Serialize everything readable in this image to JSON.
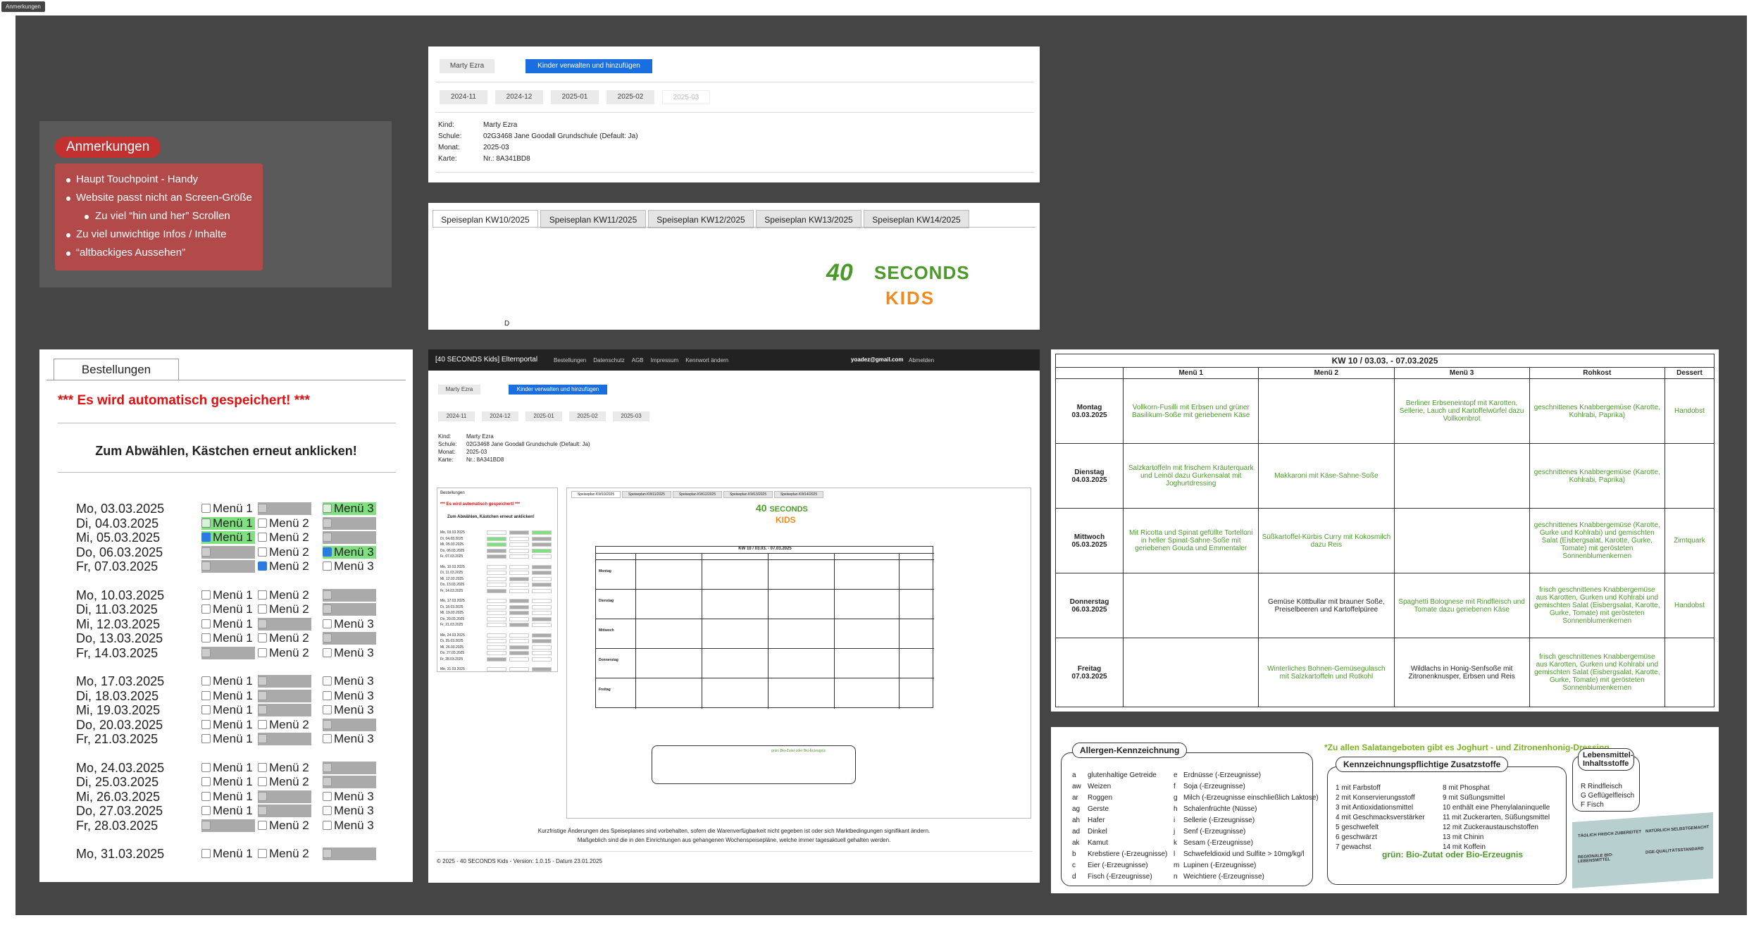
{
  "tag": "Anmerkungen",
  "notes": {
    "title": "Anmerkungen",
    "items": [
      {
        "text": "Haupt Touchpoint - Handy",
        "sub": false
      },
      {
        "text": "Website passt nicht an Screen-Größe",
        "sub": false
      },
      {
        "text": "Zu viel “hin und her” Scrollen",
        "sub": true
      },
      {
        "text": "Zu viel unwichtige Infos / Inhalte",
        "sub": false
      },
      {
        "text": "“altbackiges Aussehen”",
        "sub": false
      }
    ]
  },
  "header_card": {
    "user_button": "Marty Ezra",
    "manage_button": "Kinder verwalten und hinzufügen",
    "months": [
      "2024-11",
      "2024-12",
      "2025-01",
      "2025-02",
      "2025-03"
    ],
    "info": [
      {
        "k": "Kind:",
        "v": "Marty Ezra"
      },
      {
        "k": "Schule:",
        "v": "02G3468 Jane Goodall Grundschule (Default: Ja)"
      },
      {
        "k": "Monat:",
        "v": "2025-03"
      },
      {
        "k": "Karte:",
        "v": "Nr.: 8A341BD8"
      }
    ]
  },
  "tabs_card": {
    "tabs": [
      "Speiseplan KW10/2025",
      "Speiseplan KW11/2025",
      "Speiseplan KW12/2025",
      "Speiseplan KW13/2025",
      "Speiseplan KW14/2025"
    ],
    "logo_top": "SECONDS",
    "logo_num": "40",
    "logo_kids": "KIDS",
    "marker": "D"
  },
  "orders": {
    "tab": "Bestellungen",
    "autosave": "*** Es wird automatisch gespeichert! ***",
    "hint": "Zum Abwählen, Kästchen erneut anklicken!",
    "menu1": "Menü 1",
    "menu2": "Menü 2",
    "menu3": "Menü 3",
    "rows": [
      {
        "date": "Mo, 03.03.2025",
        "m": [
          "u",
          "b",
          "g"
        ]
      },
      {
        "date": "Di, 04.03.2025",
        "m": [
          "g",
          "u",
          "b"
        ]
      },
      {
        "date": "Mi, 05.03.2025",
        "m": [
          "gc",
          "u",
          "b"
        ]
      },
      {
        "date": "Do, 06.03.2025",
        "m": [
          "b",
          "u",
          "gc"
        ]
      },
      {
        "date": "Fr, 07.03.2025",
        "m": [
          "b",
          "c",
          "u"
        ]
      },
      {
        "date": "Mo, 10.03.2025",
        "m": [
          "u",
          "u",
          "b"
        ]
      },
      {
        "date": "Di, 11.03.2025",
        "m": [
          "u",
          "u",
          "b"
        ]
      },
      {
        "date": "Mi, 12.03.2025",
        "m": [
          "u",
          "b",
          "u"
        ]
      },
      {
        "date": "Do, 13.03.2025",
        "m": [
          "u",
          "u",
          "b"
        ]
      },
      {
        "date": "Fr, 14.03.2025",
        "m": [
          "b",
          "u",
          "u"
        ]
      },
      {
        "date": "Mo, 17.03.2025",
        "m": [
          "u",
          "b",
          "u"
        ]
      },
      {
        "date": "Di, 18.03.2025",
        "m": [
          "u",
          "b",
          "u"
        ]
      },
      {
        "date": "Mi, 19.03.2025",
        "m": [
          "u",
          "b",
          "u"
        ]
      },
      {
        "date": "Do, 20.03.2025",
        "m": [
          "u",
          "u",
          "b"
        ]
      },
      {
        "date": "Fr, 21.03.2025",
        "m": [
          "u",
          "b",
          "u"
        ]
      },
      {
        "date": "Mo, 24.03.2025",
        "m": [
          "u",
          "u",
          "b"
        ]
      },
      {
        "date": "Di, 25.03.2025",
        "m": [
          "u",
          "u",
          "b"
        ]
      },
      {
        "date": "Mi, 26.03.2025",
        "m": [
          "u",
          "b",
          "u"
        ]
      },
      {
        "date": "Do, 27.03.2025",
        "m": [
          "u",
          "b",
          "u"
        ]
      },
      {
        "date": "Fr, 28.03.2025",
        "m": [
          "b",
          "u",
          "u"
        ]
      },
      {
        "date": "Mo, 31.03.2025",
        "m": [
          "u",
          "u",
          "b"
        ]
      }
    ]
  },
  "mini": {
    "brand": "[40 SECONDS Kids] Elternportal",
    "nav": [
      "Bestellungen",
      "Datenschutz",
      "AGB",
      "Impressum",
      "Kennwort ändern"
    ],
    "email": "yoadez@gmail.com",
    "logout": "Abmelden",
    "disclaimer1": "Kurzfristige Änderungen des Speiseplanes sind vorbehalten, sofern die Warenverfügbarkeit nicht gegeben ist oder sich Marktbedingungen signifikant ändern.",
    "disclaimer2": "Maßgeblich sind die in den Einrichtungen aus gehangenen Wochenspeisepläne, welche immer tagesaktuell gehalten werden.",
    "footer": "© 2025 - 40 SECONDS Kids - Version: 1.0.15 - Datum 23.01.2025"
  },
  "week_table": {
    "title": "KW 10 / 03.03. - 07.03.2025",
    "headers": [
      "",
      "Menü 1",
      "Menü 2",
      "Menü 3",
      "Rohkost",
      "Dessert"
    ],
    "rows": [
      {
        "day": "Montag",
        "date": "03.03.2025",
        "cells": [
          "Vollkorn-Fusilli mit Erbsen und grüner Basilikum-Soße mit geriebenem Käse",
          "",
          "Berliner Erbseneintopf mit Karotten, Sellerie, Lauch und Kartoffelwürfel dazu Vollkornbrot",
          "geschnittenes Knabbergemüse (Karotte, Kohlrabi, Paprika)",
          "Handobst"
        ]
      },
      {
        "day": "Dienstag",
        "date": "04.03.2025",
        "cells": [
          "Salzkartoffeln mit frischem Kräuterquark und Leinöl dazu Gurkensalat mit Joghurtdressing",
          "Makkaroni mit Käse-Sahne-Soße",
          "",
          "geschnittenes Knabbergemüse (Karotte, Kohlrabi, Paprika)",
          ""
        ]
      },
      {
        "day": "Mittwoch",
        "date": "05.03.2025",
        "cells": [
          "Mit Ricotta und Spinat gefüllte Tortelloni in heller Spinat-Sahne-Soße mit geriebenen Gouda und Emmentaler",
          "Süßkartoffel-Kürbis Curry mit Kokosmilch dazu Reis",
          "",
          "geschnittenes Knabbergemüse (Karotte, Gurke und Kohlrabi) und gemischten Salat (Eisbergsalat, Karotte, Gurke, Tomate) mit gerösteten Sonnenblumenkernen",
          "Zimtquark"
        ]
      },
      {
        "day": "Donnerstag",
        "date": "06.03.2025",
        "cells": [
          "",
          "Gemüse Köttbullar mit brauner Soße, Preiselbeeren und Kartoffelpüree",
          "Spaghetti Bolognese mit Rindfleisch und Tomate dazu geriebenen Käse",
          "frisch geschnittenes Knabbergemüse aus Karotten, Gurken und Kohlrabi und gemischten Salat (Eisbergsalat, Karotte, Gurke, Tomate) mit gerösteten Sonnenblumenkernen",
          "Handobst"
        ]
      },
      {
        "day": "Freitag",
        "date": "07.03.2025",
        "cells": [
          "",
          "Winterliches Bohnen-Gemüsegulasch mit Salzkartoffeln und Rotkohl",
          "Wildlachs in Honig-Senfsoße mit Zitronenknusper, Erbsen und Reis",
          "frisch geschnittenes Knabbergemüse aus Karotten, Gurken und Kohlrabi und gemischten Salat (Eisbergsalat, Karotte, Gurke, Tomate) mit gerösteten Sonnenblumenkernen",
          ""
        ]
      }
    ]
  },
  "legend": {
    "allergen_title": "Allergen-Kennzeichnung",
    "allergens_left": [
      {
        "k": "a",
        "v": "glutenhaltige Getreide"
      },
      {
        "k": "aw",
        "v": "Weizen"
      },
      {
        "k": "ar",
        "v": "Roggen"
      },
      {
        "k": "ag",
        "v": "Gerste"
      },
      {
        "k": "ah",
        "v": "Hafer"
      },
      {
        "k": "ad",
        "v": "Dinkel"
      },
      {
        "k": "ak",
        "v": "Kamut"
      },
      {
        "k": "b",
        "v": "Krebstiere (-Erzeugnisse)"
      },
      {
        "k": "c",
        "v": "Eier (-Erzeugnisse)"
      },
      {
        "k": "d",
        "v": "Fisch (-Erzeugnisse)"
      }
    ],
    "allergens_right": [
      {
        "k": "e",
        "v": "Erdnüsse (-Erzeugnisse)"
      },
      {
        "k": "f",
        "v": "Soja (-Erzeugnisse)"
      },
      {
        "k": "g",
        "v": "Milch (-Erzeugnisse einschließlich Laktose)"
      },
      {
        "k": "h",
        "v": "Schalenfrüchte (Nüsse)"
      },
      {
        "k": "i",
        "v": "Sellerie (-Erzeugnisse)"
      },
      {
        "k": "j",
        "v": "Senf (-Erzeugnisse)"
      },
      {
        "k": "k",
        "v": "Sesam (-Erzeugnisse)"
      },
      {
        "k": "l",
        "v": "Schwefeldioxid und Sulfite > 10mg/kg/l"
      },
      {
        "k": "m",
        "v": "Lupinen (-Erzeugnisse)"
      },
      {
        "k": "n",
        "v": "Weichtiere (-Erzeugnisse)"
      }
    ],
    "dressing_note": "*Zu allen Salatangeboten gibt es Joghurt - und Zitronenhonig-Dressing",
    "additives_title": "Kennzeichnungspflichtige Zusatzstoffe",
    "additives_left": [
      "1 mit Farbstoff",
      "2 mit Konservierungsstoff",
      "3 mit Antioxidationsmittel",
      "4 mit Geschmacksverstärker",
      "5 geschwefelt",
      "6 geschwärzt",
      "7 gewachst"
    ],
    "additives_right": [
      "8 mit Phosphat",
      "9 mit Süßungsmittel",
      "10 enthält eine Phenylalaninquelle",
      "11 mit Zuckerarten, Süßungsmittel",
      "12 mit Zuckeraustauschstoffen",
      "13 mit Chinin",
      "14 mit Koffein"
    ],
    "bio_note": "grün: Bio-Zutat oder Bio-Erzeugnis",
    "food_title": "Lebensmittel-Inhaltsstoffe",
    "food_items": [
      "R Rindfleisch",
      "G Geflügelfleisch",
      "F Fisch"
    ],
    "badges": [
      "TÄGLICH FRISCH ZUBEREITET",
      "NATÜRLICH SELBSTGEMACHT",
      "REGIONALE BIO-LEBENSMITTEL",
      "DGE-QUALITÄTSSTANDARD"
    ]
  },
  "colors": {
    "accent_blue": "#1a6fe0",
    "brand_green": "#4a9a2a",
    "kids_orange": "#f08a1c",
    "note_red": "#c2302f"
  }
}
